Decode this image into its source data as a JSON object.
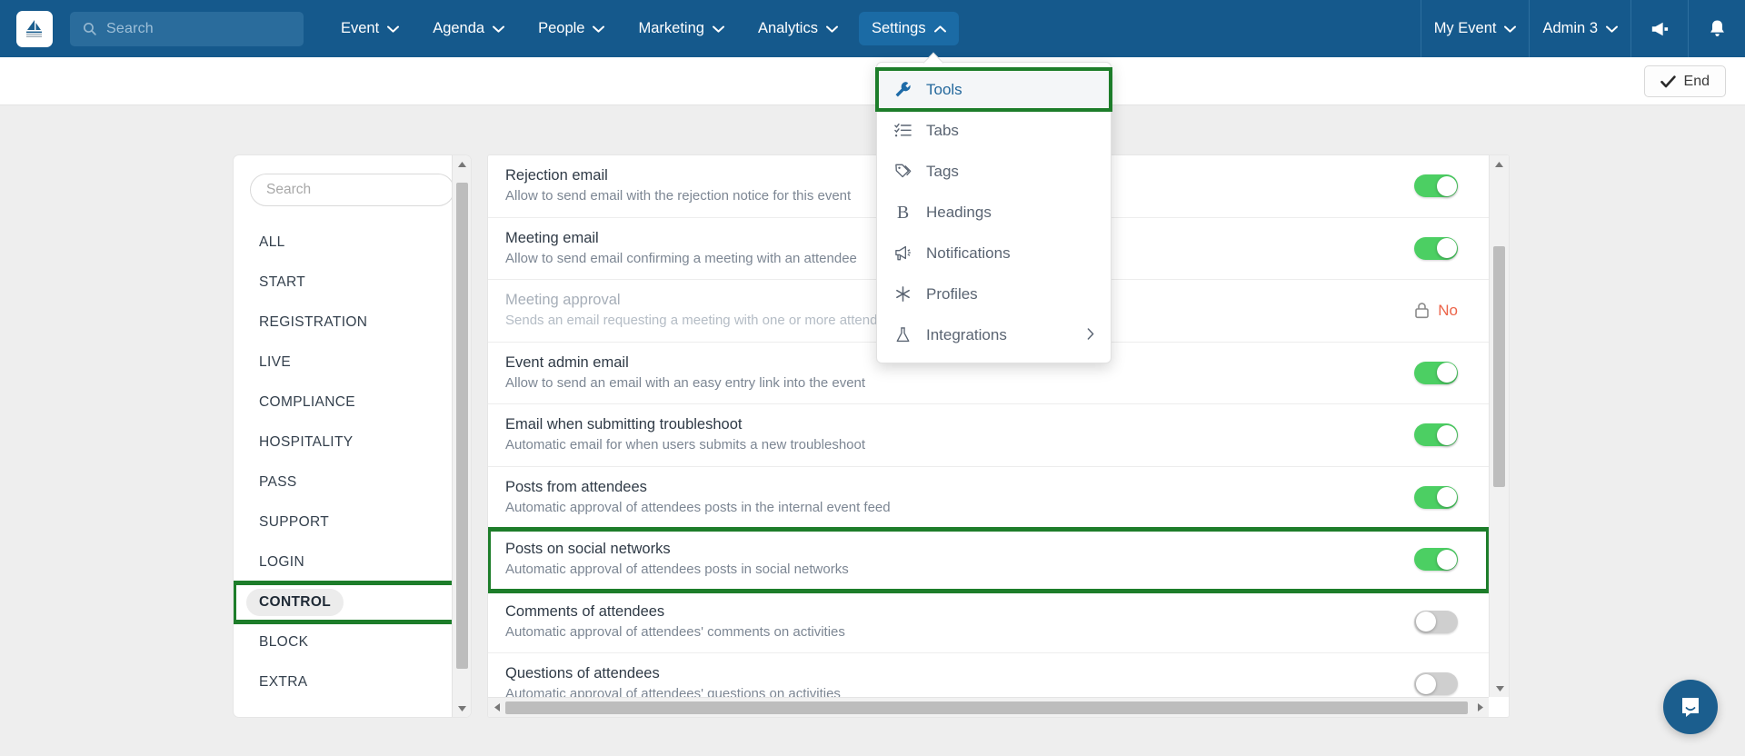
{
  "navbar": {
    "logo_icon": "sailboat-logo-icon",
    "search": {
      "placeholder": "Search",
      "icon": "search-icon"
    },
    "items": [
      {
        "label": "Event",
        "caret": "chevron-down-icon",
        "active": false
      },
      {
        "label": "Agenda",
        "caret": "chevron-down-icon",
        "active": false
      },
      {
        "label": "People",
        "caret": "chevron-down-icon",
        "active": false
      },
      {
        "label": "Marketing",
        "caret": "chevron-down-icon",
        "active": false
      },
      {
        "label": "Analytics",
        "caret": "chevron-down-icon",
        "active": false
      },
      {
        "label": "Settings",
        "caret": "chevron-up-icon",
        "active": true
      }
    ],
    "right": {
      "event_label": "My Event",
      "user_label": "Admin 3",
      "megaphone_icon": "megaphone-icon",
      "bell_icon": "bell-icon"
    },
    "bg_color": "#15598c",
    "active_color": "#1b6ba5"
  },
  "toolbar": {
    "end_label": "End",
    "end_icon": "check-icon"
  },
  "settings_menu": {
    "highlight_color": "#1d7d2a",
    "items": [
      {
        "label": "Tools",
        "icon": "wrench-icon",
        "highlighted": true,
        "submenu": false
      },
      {
        "label": "Tabs",
        "icon": "list-checks-icon",
        "highlighted": false,
        "submenu": false
      },
      {
        "label": "Tags",
        "icon": "tags-icon",
        "highlighted": false,
        "submenu": false
      },
      {
        "label": "Headings",
        "icon": "bold-b-icon",
        "highlighted": false,
        "submenu": false
      },
      {
        "label": "Notifications",
        "icon": "megaphone-icon",
        "highlighted": false,
        "submenu": false
      },
      {
        "label": "Profiles",
        "icon": "asterisk-icon",
        "highlighted": false,
        "submenu": false
      },
      {
        "label": "Integrations",
        "icon": "flask-icon",
        "highlighted": false,
        "submenu": true
      }
    ]
  },
  "facets": {
    "search_placeholder": "Search",
    "items": [
      {
        "label": "ALL",
        "selected": false,
        "boxed": false
      },
      {
        "label": "START",
        "selected": false,
        "boxed": false
      },
      {
        "label": "REGISTRATION",
        "selected": false,
        "boxed": false
      },
      {
        "label": "LIVE",
        "selected": false,
        "boxed": false
      },
      {
        "label": "COMPLIANCE",
        "selected": false,
        "boxed": false
      },
      {
        "label": "HOSPITALITY",
        "selected": false,
        "boxed": false
      },
      {
        "label": "PASS",
        "selected": false,
        "boxed": false
      },
      {
        "label": "SUPPORT",
        "selected": false,
        "boxed": false
      },
      {
        "label": "LOGIN",
        "selected": false,
        "boxed": false
      },
      {
        "label": "CONTROL",
        "selected": true,
        "boxed": true
      },
      {
        "label": "BLOCK",
        "selected": false,
        "boxed": false
      },
      {
        "label": "EXTRA",
        "selected": false,
        "boxed": false
      }
    ]
  },
  "settings_rows": [
    {
      "title": "Rejection email",
      "description": "Allow to send email with the rejection notice for this event",
      "control": "toggle",
      "value": "on",
      "disabled": false,
      "boxed": false
    },
    {
      "title": "Meeting email",
      "description": "Allow to send email confirming a meeting with an attendee",
      "control": "toggle",
      "value": "on",
      "disabled": false,
      "boxed": false
    },
    {
      "title": "Meeting approval",
      "description": "Sends an email requesting a meeting with one or more attendees",
      "control": "locked",
      "value": "No",
      "lock_icon": "lock-icon",
      "disabled": true,
      "boxed": false
    },
    {
      "title": "Event admin email",
      "description": "Allow to send an email with an easy entry link into the event",
      "control": "toggle",
      "value": "on",
      "disabled": false,
      "boxed": false
    },
    {
      "title": "Email when submitting troubleshoot",
      "description": "Automatic email for when users submits a new troubleshoot",
      "control": "toggle",
      "value": "on",
      "disabled": false,
      "boxed": false
    },
    {
      "title": "Posts from attendees",
      "description": "Automatic approval of attendees posts in the internal event feed",
      "control": "toggle",
      "value": "on",
      "disabled": false,
      "boxed": false
    },
    {
      "title": "Posts on social networks",
      "description": "Automatic approval of attendees posts in social networks",
      "control": "toggle",
      "value": "on",
      "disabled": false,
      "boxed": true
    },
    {
      "title": "Comments of attendees",
      "description": "Automatic approval of attendees' comments on activities",
      "control": "toggle",
      "value": "off",
      "disabled": false,
      "boxed": false
    },
    {
      "title": "Questions of attendees",
      "description": "Automatic approval of attendees' questions on activities",
      "control": "toggle",
      "value": "off",
      "disabled": false,
      "boxed": false
    }
  ],
  "chat": {
    "icon": "chat-bubble-icon",
    "color": "#1b5e8e"
  }
}
